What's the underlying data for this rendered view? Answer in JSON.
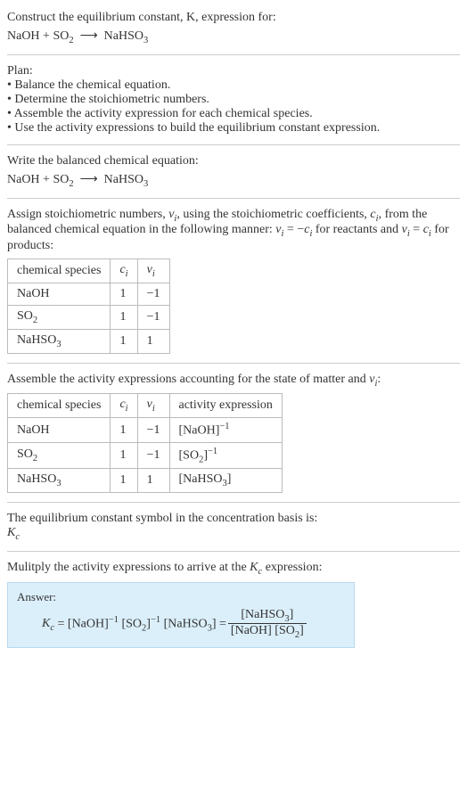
{
  "header": {
    "line1": "Construct the equilibrium constant, K, expression for:",
    "equation_html": "NaOH + SO<sub>2</sub> &nbsp;⟶&nbsp; NaHSO<sub>3</sub>"
  },
  "plan": {
    "title": "Plan:",
    "items": [
      "• Balance the chemical equation.",
      "• Determine the stoichiometric numbers.",
      "• Assemble the activity expression for each chemical species.",
      "• Use the activity expressions to build the equilibrium constant expression."
    ]
  },
  "balanced": {
    "title": "Write the balanced chemical equation:",
    "equation_html": "NaOH + SO<sub>2</sub> &nbsp;⟶&nbsp; NaHSO<sub>3</sub>"
  },
  "assign": {
    "text_html": "Assign stoichiometric numbers, <span class=\"italic\">ν<sub>i</sub></span>, using the stoichiometric coefficients, <span class=\"italic\">c<sub>i</sub></span>, from the balanced chemical equation in the following manner: <span class=\"italic\">ν<sub>i</sub></span> = −<span class=\"italic\">c<sub>i</sub></span> for reactants and <span class=\"italic\">ν<sub>i</sub></span> = <span class=\"italic\">c<sub>i</sub></span> for products:",
    "table": {
      "headers_html": [
        "chemical species",
        "<span class=\"italic\">c<sub>i</sub></span>",
        "<span class=\"italic\">ν<sub>i</sub></span>"
      ],
      "rows_html": [
        [
          "NaOH",
          "1",
          "−1"
        ],
        [
          "SO<sub>2</sub>",
          "1",
          "−1"
        ],
        [
          "NaHSO<sub>3</sub>",
          "1",
          "1"
        ]
      ]
    }
  },
  "activity": {
    "title_html": "Assemble the activity expressions accounting for the state of matter and <span class=\"italic\">ν<sub>i</sub></span>:",
    "table": {
      "headers_html": [
        "chemical species",
        "<span class=\"italic\">c<sub>i</sub></span>",
        "<span class=\"italic\">ν<sub>i</sub></span>",
        "activity expression"
      ],
      "rows_html": [
        [
          "NaOH",
          "1",
          "−1",
          "[NaOH]<sup>−1</sup>"
        ],
        [
          "SO<sub>2</sub>",
          "1",
          "−1",
          "[SO<sub>2</sub>]<sup>−1</sup>"
        ],
        [
          "NaHSO<sub>3</sub>",
          "1",
          "1",
          "[NaHSO<sub>3</sub>]"
        ]
      ]
    }
  },
  "basis": {
    "line1": "The equilibrium constant symbol in the concentration basis is:",
    "symbol_html": "<span class=\"italic\">K<sub>c</sub></span>"
  },
  "multiply": {
    "title_html": "Mulitply the activity expressions to arrive at the <span class=\"italic\">K<sub>c</sub></span> expression:"
  },
  "answer": {
    "label": "Answer:",
    "lhs_html": "<span class=\"italic\">K<sub>c</sub></span> = [NaOH]<sup>−1</sup> [SO<sub>2</sub>]<sup>−1</sup> [NaHSO<sub>3</sub>] = ",
    "frac_num_html": "[NaHSO<sub>3</sub>]",
    "frac_den_html": "[NaOH] [SO<sub>2</sub>]"
  }
}
